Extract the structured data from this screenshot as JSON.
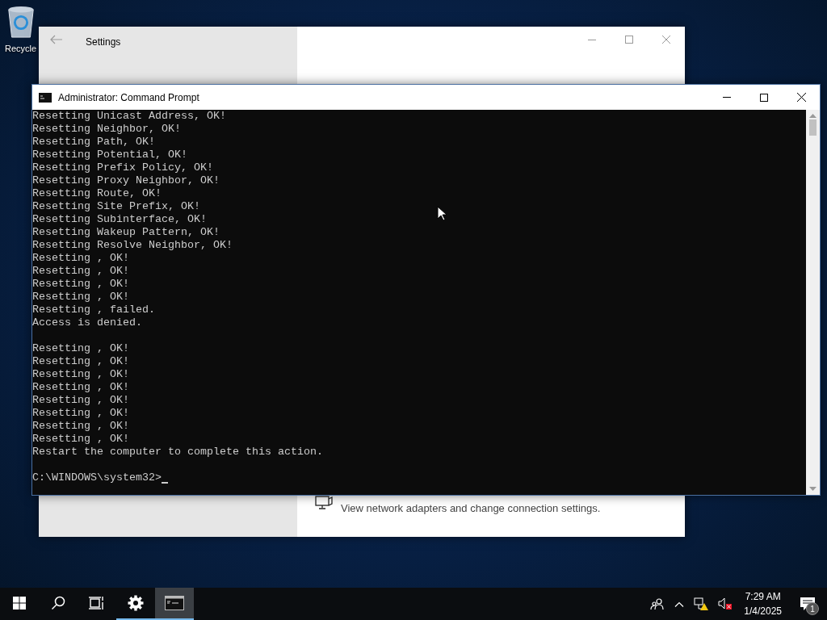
{
  "desktop": {
    "icons": [
      {
        "label": "Recycle"
      }
    ]
  },
  "settings_window": {
    "title": "Settings",
    "adapter_description": "View network adapters and change connection settings."
  },
  "console_window": {
    "title": "Administrator: Command Prompt",
    "blocks": [
      [
        "Resetting Unicast Address, OK!",
        "Resetting Neighbor, OK!",
        "Resetting Path, OK!",
        "Resetting Potential, OK!",
        "Resetting Prefix Policy, OK!",
        "Resetting Proxy Neighbor, OK!",
        "Resetting Route, OK!",
        "Resetting Site Prefix, OK!",
        "Resetting Subinterface, OK!",
        "Resetting Wakeup Pattern, OK!",
        "Resetting Resolve Neighbor, OK!",
        "Resetting , OK!",
        "Resetting , OK!",
        "Resetting , OK!",
        "Resetting , OK!",
        "Resetting , failed.",
        "Access is denied."
      ],
      [
        "Resetting , OK!",
        "Resetting , OK!",
        "Resetting , OK!",
        "Resetting , OK!",
        "Resetting , OK!",
        "Resetting , OK!",
        "Resetting , OK!",
        "Resetting , OK!",
        "Restart the computer to complete this action."
      ]
    ],
    "prompt": "C:\\WINDOWS\\system32>"
  },
  "taskbar": {
    "items": [
      {
        "kind": "start",
        "running": false,
        "selected": false
      },
      {
        "kind": "search",
        "running": false,
        "selected": false
      },
      {
        "kind": "task-view",
        "running": false,
        "selected": false
      },
      {
        "kind": "settings",
        "running": true,
        "selected": false
      },
      {
        "kind": "console",
        "running": true,
        "selected": true
      }
    ],
    "clock": {
      "time": "7:29 AM",
      "date": "1/4/2025"
    },
    "notifications": {
      "count": "1"
    }
  }
}
